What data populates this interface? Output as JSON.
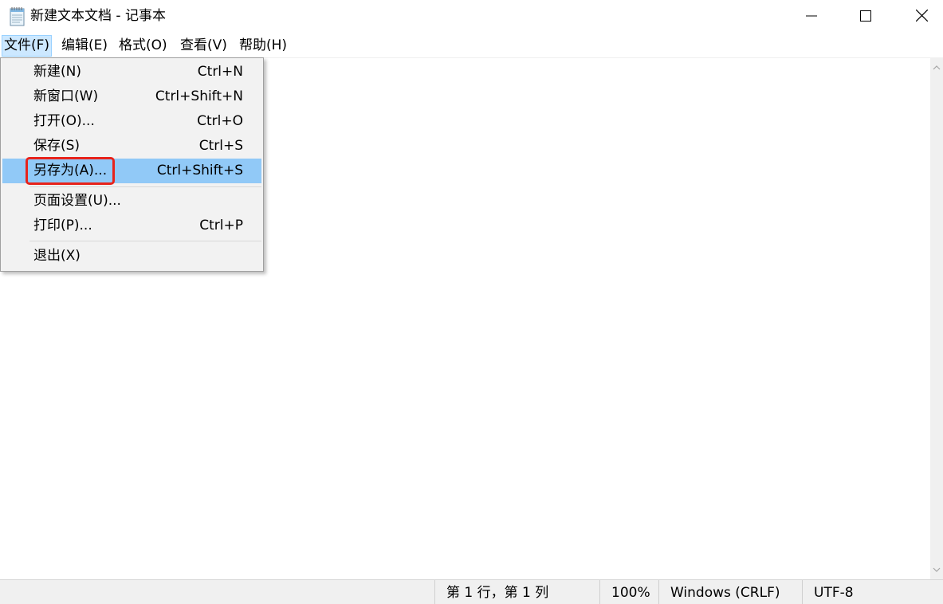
{
  "window": {
    "title": "新建文本文档 - 记事本",
    "app_icon": "notepad-icon",
    "controls": {
      "minimize_icon": "minimize-icon",
      "maximize_icon": "maximize-icon",
      "close_icon": "close-icon"
    }
  },
  "menubar": {
    "items": [
      {
        "label": "文件(F)"
      },
      {
        "label": "编辑(E)"
      },
      {
        "label": "格式(O)"
      },
      {
        "label": "查看(V)"
      },
      {
        "label": "帮助(H)"
      }
    ]
  },
  "file_menu": {
    "items": [
      {
        "label": "新建(N)",
        "shortcut": "Ctrl+N"
      },
      {
        "label": "新窗口(W)",
        "shortcut": "Ctrl+Shift+N"
      },
      {
        "label": "打开(O)...",
        "shortcut": "Ctrl+O"
      },
      {
        "label": "保存(S)",
        "shortcut": "Ctrl+S"
      },
      {
        "label": "另存为(A)...",
        "shortcut": "Ctrl+Shift+S"
      },
      {
        "label": "页面设置(U)...",
        "shortcut": ""
      },
      {
        "label": "打印(P)...",
        "shortcut": "Ctrl+P"
      },
      {
        "label": "退出(X)",
        "shortcut": ""
      }
    ],
    "highlighted_item": "另存为(A)..."
  },
  "editor": {
    "content": ""
  },
  "statusbar": {
    "position": "第 1 行，第 1 列",
    "zoom": "100%",
    "line_ending": "Windows (CRLF)",
    "encoding": "UTF-8"
  },
  "colors": {
    "menu_highlight": "#91c9f7",
    "menubar_active": "#cce8ff",
    "annotation_box": "#e8231b",
    "menu_background": "#f2f2f2",
    "statusbar_background": "#f0f0f0"
  }
}
